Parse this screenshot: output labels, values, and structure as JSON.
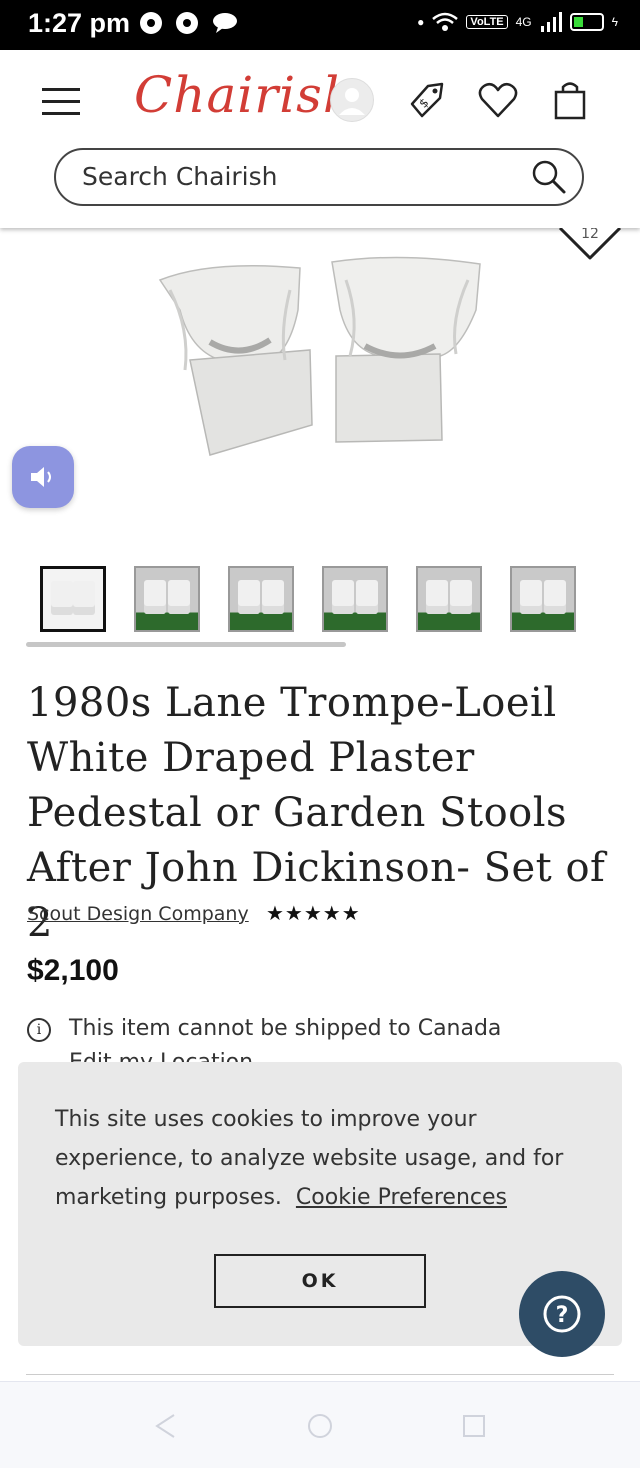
{
  "status_bar": {
    "time": "1:27 pm",
    "volte": "VoLTE",
    "network": "4G"
  },
  "header": {
    "logo": "Chairish",
    "search_placeholder": "Search Chairish"
  },
  "product": {
    "favorite_count": "12",
    "thumbnail_count": 6,
    "title": "1980s Lane Trompe-Loeil White Draped Plaster Pedestal or Garden Stools After John Dickinson- Set of 2",
    "seller": "Scout Design Company",
    "rating_stars": "★★★★★",
    "price": "$2,100",
    "shipping_notice": "This item cannot be shipped to Canada",
    "edit_location": "Edit my Location"
  },
  "cookie_banner": {
    "text": "This site uses cookies to improve your experience, to analyze website usage, and for marketing purposes.",
    "link": "Cookie Preferences",
    "ok_label": "OK"
  },
  "colors": {
    "brand_red": "#d23d36",
    "help_button": "#2e4c66",
    "audio_button": "#8d95e0"
  }
}
